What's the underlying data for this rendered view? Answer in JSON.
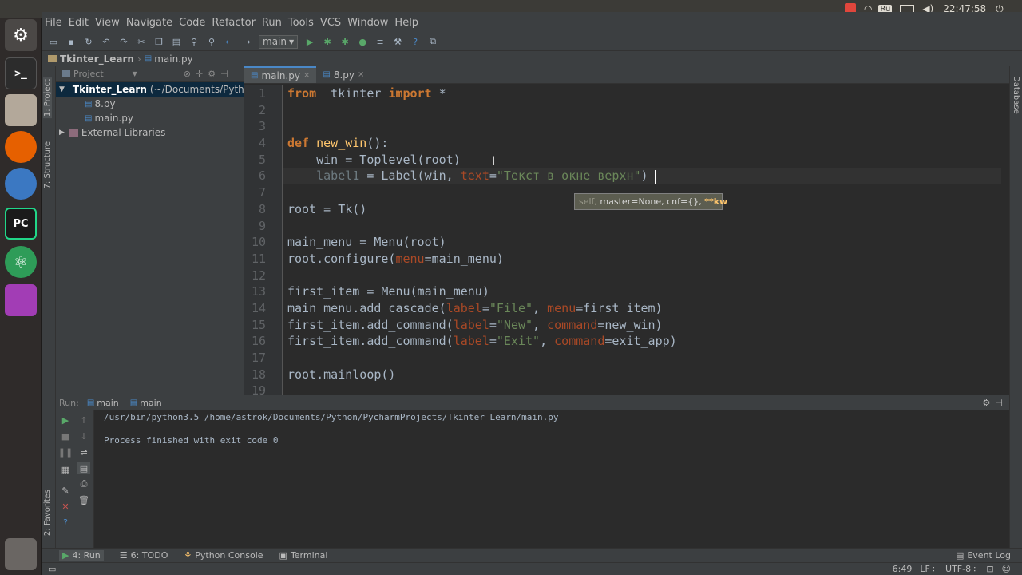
{
  "system": {
    "keyboard_layout": "Ru",
    "clock": "22:47:58"
  },
  "menubar": {
    "items": [
      "File",
      "Edit",
      "View",
      "Navigate",
      "Code",
      "Refactor",
      "Run",
      "Tools",
      "VCS",
      "Window",
      "Help"
    ]
  },
  "toolbar": {
    "run_config": "main"
  },
  "navbar": {
    "crumbs": [
      "Tkinter_Learn",
      "main.py"
    ]
  },
  "project": {
    "header": "Project",
    "root_label": "Tkinter_Learn",
    "root_path": "(~/Documents/Python/",
    "files": [
      "8.py",
      "main.py"
    ],
    "external": "External Libraries"
  },
  "side_tabs": {
    "project": "1: Project",
    "structure": "7: Structure",
    "favorites": "2: Favorites",
    "database": "Database"
  },
  "editor": {
    "tabs": [
      {
        "label": "main.py",
        "active": true
      },
      {
        "label": "8.py",
        "active": false
      }
    ],
    "line_numbers": [
      "1",
      "2",
      "3",
      "4",
      "5",
      "6",
      "7",
      "8",
      "9",
      "10",
      "11",
      "12",
      "13",
      "14",
      "15",
      "16",
      "17",
      "18",
      "19"
    ],
    "tooltip_self": "self,",
    "tooltip_rest": " master=None, cnf={}, ",
    "tooltip_kw": "**kw"
  },
  "run": {
    "label": "Run:",
    "tab1": "main",
    "tab2": "main",
    "command": "/usr/bin/python3.5 /home/astrok/Documents/Python/PycharmProjects/Tkinter_Learn/main.py",
    "result": "Process finished with exit code 0"
  },
  "bottom_tabs": {
    "run": "4: Run",
    "todo": "6: TODO",
    "console": "Python Console",
    "terminal": "Terminal",
    "event_log": "Event Log"
  },
  "status": {
    "position": "6:49",
    "line_sep": "LF÷",
    "encoding": "UTF-8÷"
  },
  "colors": {
    "keyword": "#cc7832",
    "function": "#ffc66d",
    "string": "#6a8759",
    "param": "#aa4926",
    "text": "#a9b7c6"
  }
}
